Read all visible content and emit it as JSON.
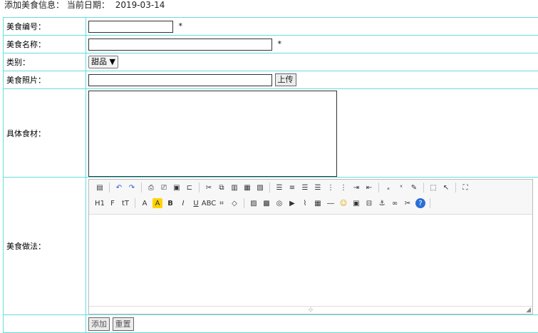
{
  "header": {
    "title": "添加美食信息：",
    "date_label": "当前日期：",
    "date": "2019-03-14"
  },
  "form": {
    "food_no_label": "美食编号：",
    "food_no_value": "",
    "required": "*",
    "food_name_label": "美食名称：",
    "food_name_value": "",
    "category_label": "类别：",
    "category_value": "甜品 ▼",
    "photo_label": "美食照片：",
    "photo_value": "",
    "upload_button": "上传",
    "ingredients_label": "具体食材：",
    "ingredients_value": "",
    "method_label": "美食做法：",
    "submit_button": "添加",
    "reset_button": "重置"
  },
  "toolbar_text": {
    "heading": "H1",
    "font": "F",
    "fontsize": "tT",
    "bold": "B",
    "italic": "I",
    "underline": "U",
    "strike": "ABC",
    "grip": "⊹"
  },
  "toolbar_icons_row1": [
    "source-icon",
    "undo-icon",
    "redo-icon",
    "preview-icon",
    "print-icon",
    "template-icon",
    "code-icon",
    "cut-icon",
    "copy-icon",
    "paste-icon",
    "paste-text-icon",
    "paste-word-icon",
    "align-left-icon",
    "align-center-icon",
    "align-right-icon",
    "justify-icon",
    "ordered-list-icon",
    "unordered-list-icon",
    "indent-icon",
    "outdent-icon",
    "subscript-icon",
    "superscript-icon",
    "clear-format-icon",
    "select-all-icon",
    "cursor-icon",
    "fullscreen-icon"
  ],
  "toolbar_icons_row2": [
    "heading-icon",
    "font-family-icon",
    "font-size-icon",
    "font-color-icon",
    "highlight-icon",
    "bold-icon",
    "italic-icon",
    "underline-icon",
    "strikethrough-icon",
    "line-height-icon",
    "remove-format-icon",
    "image-icon",
    "multi-image-icon",
    "flash-icon",
    "media-icon",
    "attachment-icon",
    "table-icon",
    "horizontal-rule-icon",
    "emoticon-icon",
    "map-icon",
    "pagebreak-icon",
    "anchor-icon",
    "link-icon",
    "unlink-icon",
    "help-icon"
  ]
}
